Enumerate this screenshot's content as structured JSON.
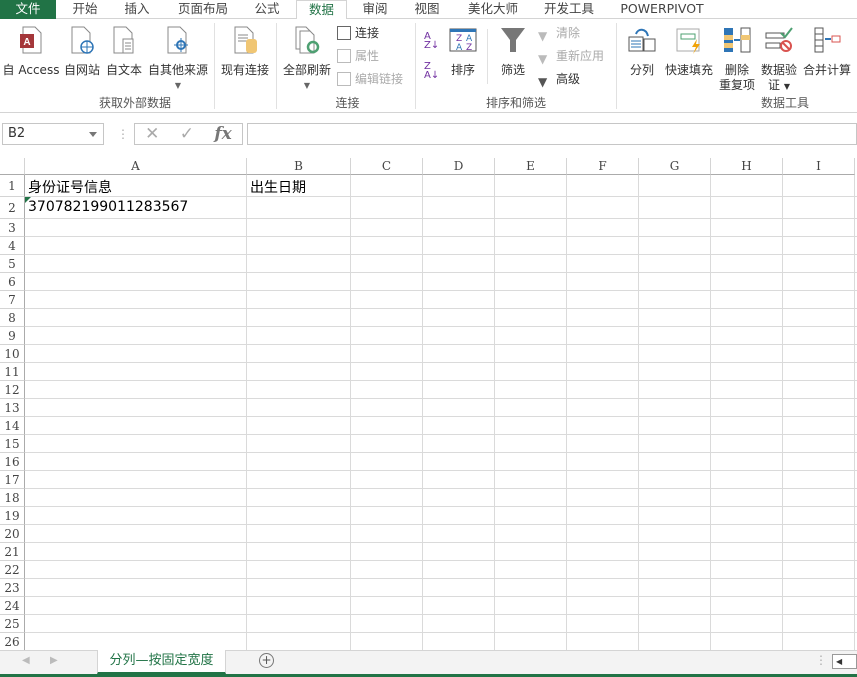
{
  "ribbon_tabs": [
    "文件",
    "开始",
    "插入",
    "页面布局",
    "公式",
    "数据",
    "审阅",
    "视图",
    "美化大师",
    "开发工具",
    "POWERPIVOT"
  ],
  "groups": {
    "external": {
      "label": "获取外部数据",
      "access": "自 Access",
      "web": "自网站",
      "text": "自文本",
      "other": "自其他来源",
      "existing": "现有连接"
    },
    "connections": {
      "label": "连接",
      "refresh_all": "全部刷新",
      "connections": "连接",
      "properties": "属性",
      "edit_links": "编辑链接"
    },
    "sort_filter": {
      "label": "排序和筛选",
      "sort": "排序",
      "filter": "筛选",
      "clear": "清除",
      "reapply": "重新应用",
      "advanced": "高级"
    },
    "data_tools": {
      "label": "数据工具",
      "text_to_columns": "分列",
      "flash_fill": "快速填充",
      "remove_dup_1": "删除",
      "remove_dup_2": "重复项",
      "validation_1": "数据验",
      "validation_2": "证",
      "consolidate": "合并计算"
    }
  },
  "formula_bar": {
    "name_box": "B2",
    "cancel": "✕",
    "enter": "✓",
    "fx": "fx",
    "formula": ""
  },
  "columns": [
    "A",
    "B",
    "C",
    "D",
    "E",
    "F",
    "G",
    "H",
    "I"
  ],
  "rows": [
    "1",
    "2",
    "3",
    "4",
    "5",
    "6",
    "7",
    "8",
    "9",
    "10",
    "11",
    "12",
    "13",
    "14",
    "15",
    "16",
    "17",
    "18",
    "19",
    "20",
    "21",
    "22",
    "23",
    "24",
    "25",
    "26"
  ],
  "cells": {
    "A1": "身份证号信息",
    "B1": "出生日期",
    "A2": "370782199011283567"
  },
  "sheet_tabs": [
    "分列—按固定宽度"
  ],
  "colors": {
    "accent": "#217346"
  }
}
